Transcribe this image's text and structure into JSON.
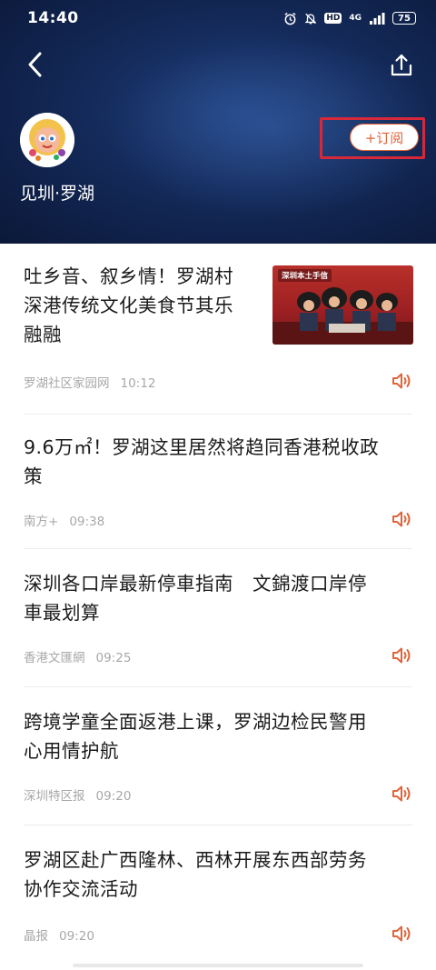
{
  "status_bar": {
    "time": "14:40",
    "network": "4G",
    "hd": "HD",
    "battery": "75"
  },
  "header": {
    "channel_name": "见圳·罗湖",
    "subscribe_label": "+订阅",
    "accent_color": "#e0643a",
    "highlight_color": "#d8283a"
  },
  "articles": [
    {
      "title_lines": [
        "吐乡音、叙乡情！罗湖村",
        "深港传统文化美食节其乐",
        "融融"
      ],
      "source": "罗湖社区家园网",
      "time": "10:12",
      "thumbnail_caption": "深圳本土手信"
    },
    {
      "title_lines": [
        "9.6万㎡！罗湖这里居然将趋同香港税收政",
        "策"
      ],
      "source": "南方+",
      "time": "09:38"
    },
    {
      "title_lines": [
        "深圳各口岸最新停車指南　文錦渡口岸停",
        "車最划算"
      ],
      "source": "香港文匯網",
      "time": "09:25"
    },
    {
      "title_lines": [
        "跨境学童全面返港上课，罗湖边检民警用",
        "心用情护航"
      ],
      "source": "深圳特区报",
      "time": "09:20"
    },
    {
      "title_lines": [
        "罗湖区赴广西隆林、西林开展东西部劳务",
        "协作交流活动"
      ],
      "source": "晶报",
      "time": "09:20"
    }
  ]
}
